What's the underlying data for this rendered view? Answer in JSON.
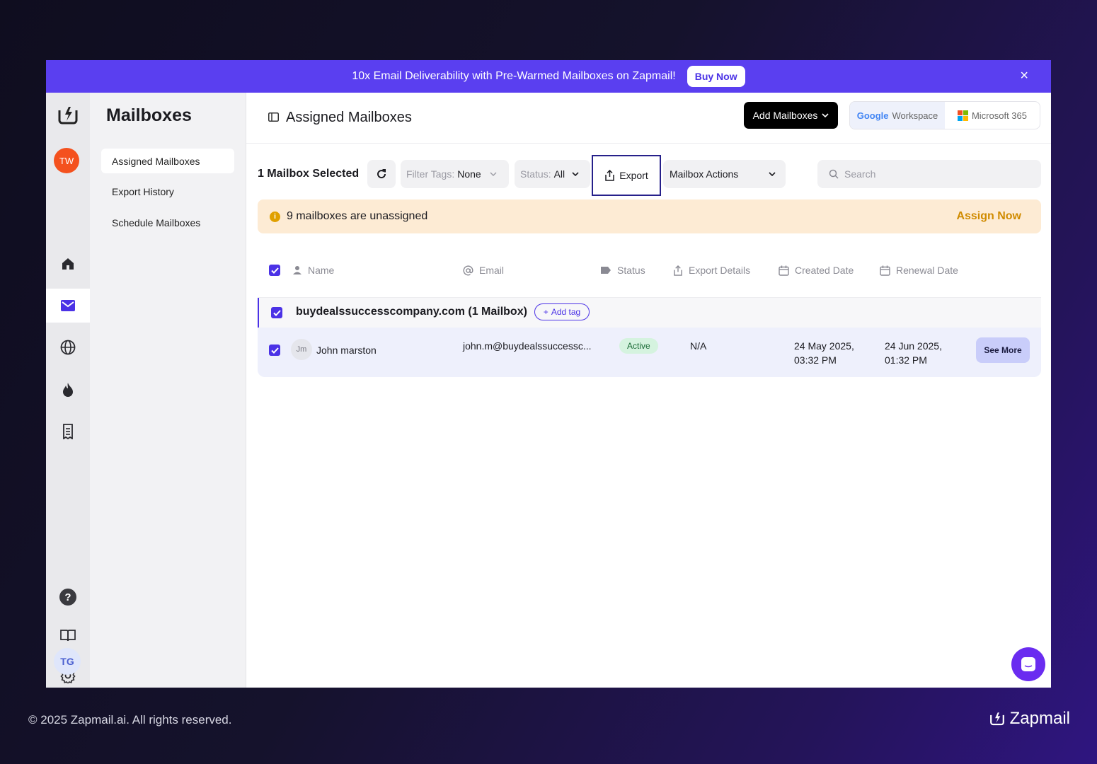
{
  "banner": {
    "message": "10x Email Deliverability with Pre-Warmed Mailboxes on Zapmail!",
    "buy_label": "Buy Now",
    "close_label": "×"
  },
  "rail": {
    "user_initials": "TW",
    "bottom_initials": "TG",
    "icons": [
      "logo-icon",
      "home-icon",
      "mail-icon",
      "globe-icon",
      "fire-icon",
      "receipt-icon",
      "help-icon",
      "book-icon",
      "gear-icon"
    ]
  },
  "subnav": {
    "title": "Mailboxes",
    "items": [
      {
        "label": "Assigned Mailboxes",
        "selected": true
      },
      {
        "label": "Export History",
        "selected": false
      },
      {
        "label": "Schedule Mailboxes",
        "selected": false
      }
    ]
  },
  "header": {
    "title": "Assigned Mailboxes",
    "add_label": "Add Mailboxes",
    "google_label": "Workspace",
    "google_word": "Google",
    "microsoft_label": "Microsoft 365"
  },
  "toolbar": {
    "selected_text": "1 Mailbox Selected",
    "filter_tags_label": "Filter Tags:",
    "filter_tags_value": "None",
    "status_label": "Status:",
    "status_value": "All",
    "export_label": "Export",
    "actions_label": "Mailbox Actions",
    "search_placeholder": "Search"
  },
  "alert": {
    "icon": "i",
    "message": "9 mailboxes are unassigned",
    "action": "Assign Now"
  },
  "table": {
    "columns": [
      "Name",
      "Email",
      "Status",
      "Export Details",
      "Created Date",
      "Renewal Date"
    ],
    "group": {
      "domain": "buydealssuccesscompany.com (1 Mailbox)",
      "add_tag": "Add tag"
    },
    "rows": [
      {
        "initials": "Jm",
        "name": "John marston",
        "email": "john.m@buydealssuccessc...",
        "status": "Active",
        "export": "N/A",
        "created_date": "24 May 2025,",
        "created_time": "03:32 PM",
        "renewal_date": "24 Jun 2025,",
        "renewal_time": "01:32 PM",
        "action": "See More"
      }
    ]
  },
  "footer": {
    "copyright": "© 2025 Zapmail.ai. All rights reserved.",
    "brand": "Zapmail"
  },
  "colors": {
    "accent": "#5a3ff0",
    "checkbox": "#4b32e6",
    "alert_bg": "#fdebd4",
    "assign": "#d08b00",
    "active_badge": "#d5f3df"
  }
}
